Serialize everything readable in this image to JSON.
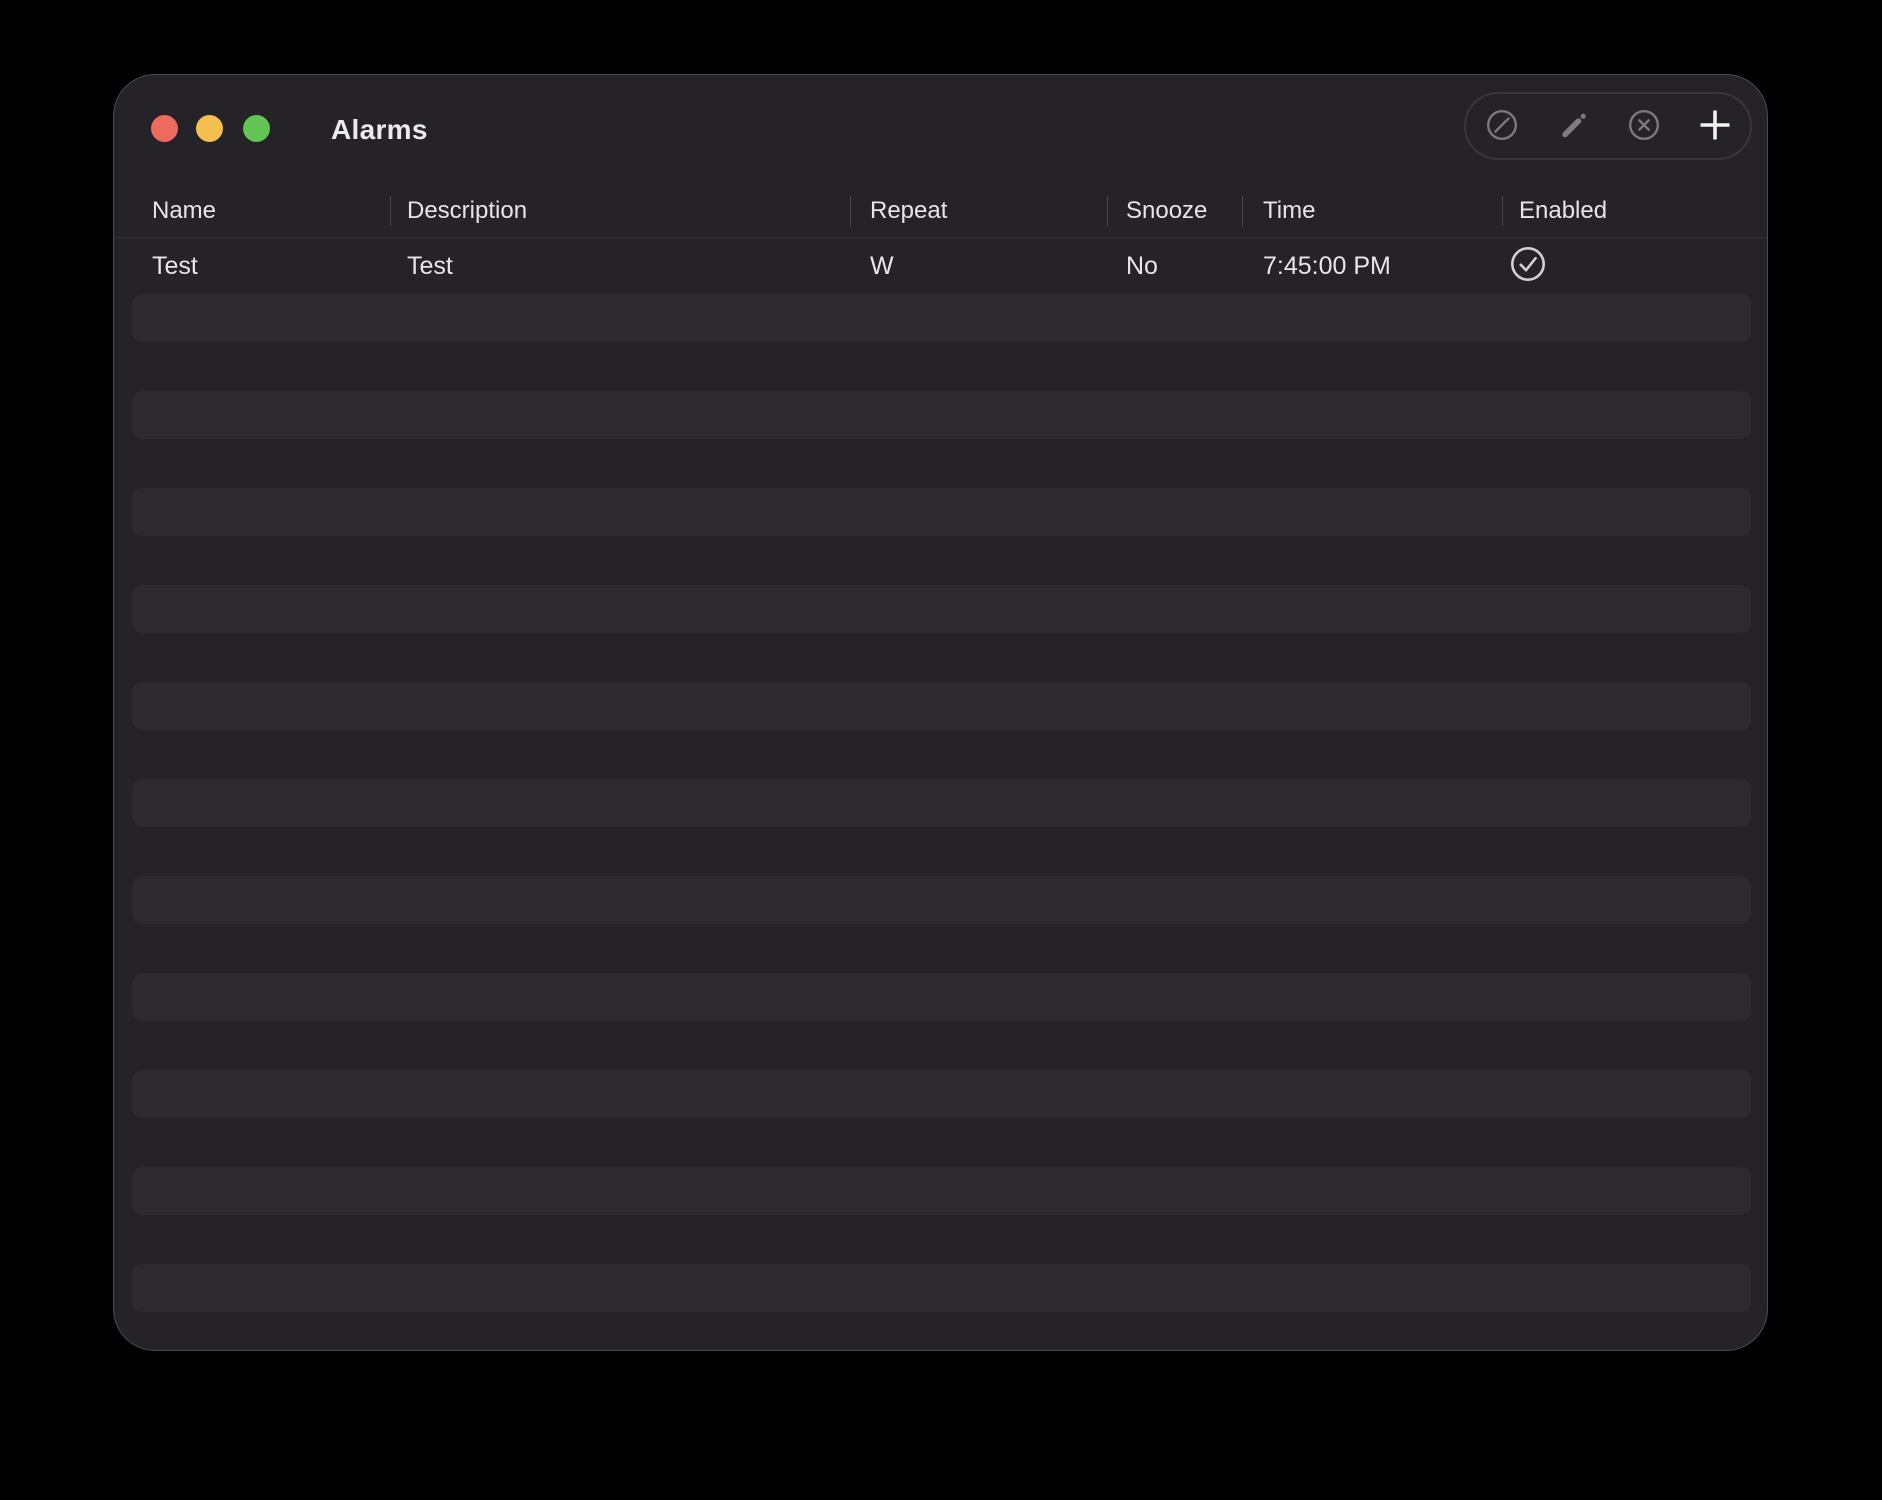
{
  "window": {
    "title": "Alarms"
  },
  "traffic_lights": {
    "close_color": "#ed6a5e",
    "minimize_color": "#f5bf4f",
    "zoom_color": "#61c454"
  },
  "toolbar": {
    "buttons": [
      {
        "icon": "circle-slash-icon",
        "state": "muted"
      },
      {
        "icon": "pencil-icon",
        "state": "muted"
      },
      {
        "icon": "x-circle-icon",
        "state": "muted"
      },
      {
        "icon": "plus-icon",
        "state": "bright"
      }
    ],
    "muted_icon_color": "#7b797f",
    "bright_icon_color": "#f3f2f4"
  },
  "table": {
    "columns": [
      "Name",
      "Description",
      "Repeat",
      "Snooze",
      "Time",
      "Enabled"
    ],
    "rows": [
      {
        "name": "Test",
        "description": "Test",
        "repeat": "W",
        "snooze": "No",
        "time": "7:45:00 PM",
        "enabled": true,
        "enabled_icon": "check-circle-icon"
      }
    ],
    "empty_row_count": 11
  }
}
